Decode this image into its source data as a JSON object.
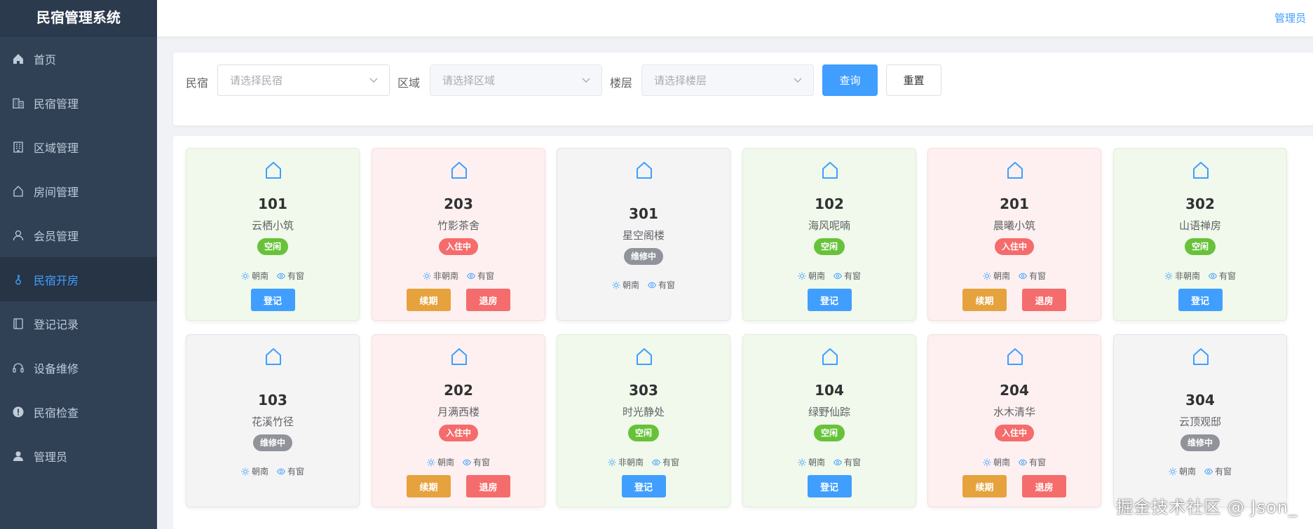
{
  "app": {
    "title": "民宿管理系统"
  },
  "header": {
    "user_label": "管理员"
  },
  "colors": {
    "sidebar_bg": "#304156",
    "accent": "#409eff",
    "free": "#67c23a",
    "occupied": "#f56c6c",
    "repair": "#909399",
    "renew": "#e6a23c"
  },
  "sidebar": {
    "items": [
      {
        "label": "首页",
        "icon": "home-icon"
      },
      {
        "label": "民宿管理",
        "icon": "building-icon"
      },
      {
        "label": "区域管理",
        "icon": "office-icon"
      },
      {
        "label": "房间管理",
        "icon": "house-icon"
      },
      {
        "label": "会员管理",
        "icon": "user-icon"
      },
      {
        "label": "民宿开房",
        "icon": "key-icon",
        "active": true
      },
      {
        "label": "登记记录",
        "icon": "notebook-icon"
      },
      {
        "label": "设备维修",
        "icon": "headset-icon"
      },
      {
        "label": "民宿检查",
        "icon": "warning-icon"
      },
      {
        "label": "管理员",
        "icon": "avatar-icon"
      }
    ]
  },
  "filter": {
    "homestay_label": "民宿",
    "homestay_placeholder": "请选择民宿",
    "area_label": "区域",
    "area_placeholder": "请选择区域",
    "floor_label": "楼层",
    "floor_placeholder": "请选择楼层",
    "query_button": "查询",
    "reset_button": "重置"
  },
  "rooms": [
    {
      "number": "101",
      "name": "云栖小筑",
      "status": "free",
      "status_label": "空闲",
      "orientation": "朝南",
      "window": "有窗",
      "actions": [
        "登记"
      ]
    },
    {
      "number": "203",
      "name": "竹影茶舍",
      "status": "occupied",
      "status_label": "入住中",
      "orientation": "非朝南",
      "window": "有窗",
      "actions": [
        "续期",
        "退房"
      ]
    },
    {
      "number": "301",
      "name": "星空阁楼",
      "status": "repair",
      "status_label": "维修中",
      "orientation": "朝南",
      "window": "有窗",
      "actions": []
    },
    {
      "number": "102",
      "name": "海风呢喃",
      "status": "free",
      "status_label": "空闲",
      "orientation": "朝南",
      "window": "有窗",
      "actions": [
        "登记"
      ]
    },
    {
      "number": "201",
      "name": "晨曦小筑",
      "status": "occupied",
      "status_label": "入住中",
      "orientation": "朝南",
      "window": "有窗",
      "actions": [
        "续期",
        "退房"
      ]
    },
    {
      "number": "302",
      "name": "山语禅房",
      "status": "free",
      "status_label": "空闲",
      "orientation": "非朝南",
      "window": "有窗",
      "actions": [
        "登记"
      ]
    },
    {
      "number": "103",
      "name": "花溪竹径",
      "status": "repair",
      "status_label": "维修中",
      "orientation": "朝南",
      "window": "有窗",
      "actions": []
    },
    {
      "number": "202",
      "name": "月满西楼",
      "status": "occupied",
      "status_label": "入住中",
      "orientation": "朝南",
      "window": "有窗",
      "actions": [
        "续期",
        "退房"
      ]
    },
    {
      "number": "303",
      "name": "时光静处",
      "status": "free",
      "status_label": "空闲",
      "orientation": "非朝南",
      "window": "有窗",
      "actions": [
        "登记"
      ]
    },
    {
      "number": "104",
      "name": "绿野仙踪",
      "status": "free",
      "status_label": "空闲",
      "orientation": "朝南",
      "window": "有窗",
      "actions": [
        "登记"
      ]
    },
    {
      "number": "204",
      "name": "水木清华",
      "status": "occupied",
      "status_label": "入住中",
      "orientation": "朝南",
      "window": "有窗",
      "actions": [
        "续期",
        "退房"
      ]
    },
    {
      "number": "304",
      "name": "云顶观邸",
      "status": "repair",
      "status_label": "维修中",
      "orientation": "朝南",
      "window": "有窗",
      "actions": []
    }
  ],
  "watermark": "掘金技术社区 @ Json_"
}
